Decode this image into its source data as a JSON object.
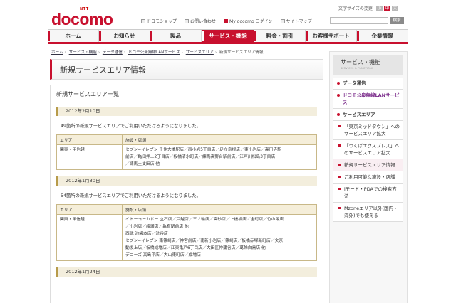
{
  "header": {
    "logo": "docomo",
    "logo_sup": "NTT",
    "font_size_label": "文字サイズの変更",
    "font_sizes": [
      "小",
      "中",
      "大"
    ],
    "utility_links": [
      "ドコモショップ",
      "お問い合わせ",
      "My docomo ログイン",
      "サイトマップ"
    ],
    "search_button": "検索"
  },
  "nav": {
    "tabs": [
      "ホーム",
      "お知らせ",
      "製品",
      "サービス・機能",
      "料金・割引",
      "お客様サポート",
      "企業情報"
    ],
    "active": "サービス・機能"
  },
  "breadcrumb": [
    "ホーム",
    "サービス・機能",
    "データ通信",
    "ドコモ公衆無線LANサービス",
    "サービスエリア",
    "新規サービスエリア情報"
  ],
  "page_title": "新規サービスエリア情報",
  "content": {
    "section_title": "新規サービスエリア一覧",
    "table_headers": {
      "area": "エリア",
      "shops": "施設・店舗"
    },
    "updates": [
      {
        "date": "2012年2月10日",
        "note": "49箇所の新規サービスエリアでご利用いただけるようになりました。",
        "area": "関東・甲信越",
        "shops": "セブン−イレブン 千住大橋駅店／南小岩5丁目店／足立島根店／東小岩店／高円寺駅\n前店／亀田押上2丁目店／板橋清水町店／練馬高野台駅前店／江戸川松島3丁目店\n／練馬土支田店 他"
      },
      {
        "date": "2012年1月30日",
        "note": "54箇所の新規サービスエリアでご利用いただけるようになりました。",
        "area": "関東・甲信越",
        "shops": "イトーヨーカドー 立石店／戸越店／三ノ輪店／高砂店／上板橋店／金町店／竹の塚店\n／小岩店／綾瀬店／亀有駅前店 他\n西武 池袋本店／渋谷店\nセブン−イレブン 南篠崎店／神宮前店／南新小岩店／篠崎店／板橋赤塚新町店／文京\n動坂上店／板橋成増店／江東亀戸6丁目店／大田区仲蒲谷店／葛飾白鳥店 他\nデニーズ 高島平店／大山東町店／成増店"
      },
      {
        "date": "2012年1月24日",
        "note": "",
        "area": "",
        "shops": ""
      }
    ]
  },
  "sidebar": {
    "title": "サービス・機能",
    "title_sub": "SERVICES & FUNCTIONS",
    "items": [
      {
        "label": "データ通信"
      },
      {
        "label": "ドコモ公衆無線LANサービス"
      },
      {
        "label": "サービスエリア"
      },
      {
        "label": "「東京ミッドタウン」へのサービスエリア拡大"
      },
      {
        "label": "「つくばエクスプレス」へのサービスエリア拡大"
      },
      {
        "label": "新規サービスエリア情報"
      },
      {
        "label": "ご利用可能な施設・店舗"
      },
      {
        "label": "iモード・PDAでの検索方法"
      },
      {
        "label": "Mzoneエリア以外(国内・海外)でも使える"
      }
    ]
  },
  "colors": {
    "brand": "#c8102e",
    "date_bar": "#f3eedd"
  }
}
